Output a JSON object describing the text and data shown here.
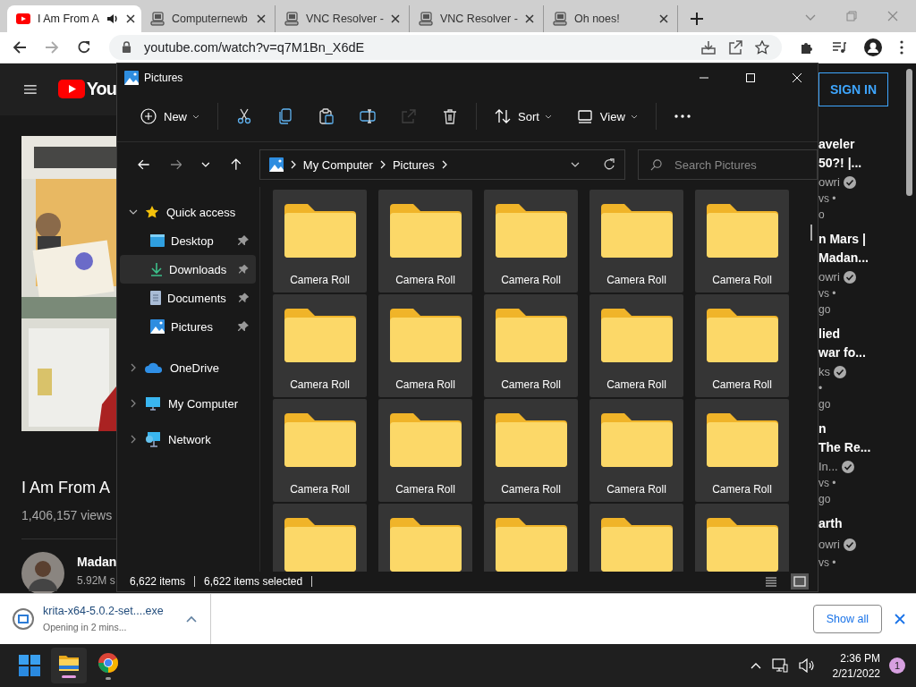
{
  "browser": {
    "tabs": [
      {
        "title": "I Am From A",
        "kind": "youtube",
        "audio": true,
        "selected": true
      },
      {
        "title": "Computernewb",
        "kind": "vnc",
        "audio": false,
        "selected": false
      },
      {
        "title": "VNC Resolver -",
        "kind": "vnc",
        "audio": false,
        "selected": false
      },
      {
        "title": "VNC Resolver -",
        "kind": "vnc",
        "audio": false,
        "selected": false
      },
      {
        "title": "Oh noes!",
        "kind": "vnc",
        "audio": false,
        "selected": false
      }
    ],
    "address": "youtube.com/watch?v=q7M1Bn_X6dE"
  },
  "youtube": {
    "logo_text": "You",
    "video_title": "I Am From A",
    "views": "1,406,157 views",
    "channel_name": "Madan",
    "subscribers": "5.92M s",
    "sign_in": "SIGN IN",
    "recommendations": [
      {
        "title_lines": [
          "aveler",
          "50?! |..."
        ],
        "channel": "owri",
        "verified": true,
        "meta_lines": [
          "vs •",
          "o"
        ]
      },
      {
        "title_lines": [
          "n Mars |",
          "Madan..."
        ],
        "channel": "owri",
        "verified": true,
        "meta_lines": [
          "vs •",
          "go"
        ]
      },
      {
        "title_lines": [
          "lied",
          "war fo..."
        ],
        "channel": "ks",
        "verified": true,
        "meta_lines": [
          "•",
          "go"
        ]
      },
      {
        "title_lines": [
          "n",
          "The Re..."
        ],
        "channel": "In...",
        "verified": true,
        "meta_lines": [
          "vs •",
          "go"
        ]
      },
      {
        "title_lines": [
          "arth"
        ],
        "channel": "owri",
        "verified": true,
        "meta_lines": [
          "vs •"
        ]
      }
    ]
  },
  "explorer": {
    "title": "Pictures",
    "toolbar": [
      {
        "kind": "new",
        "label": "New",
        "disabled": false
      },
      {
        "kind": "separator"
      },
      {
        "kind": "cut",
        "disabled": false
      },
      {
        "kind": "copy",
        "disabled": false
      },
      {
        "kind": "paste",
        "disabled": false
      },
      {
        "kind": "rename",
        "disabled": false
      },
      {
        "kind": "share",
        "disabled": true
      },
      {
        "kind": "delete",
        "disabled": false
      },
      {
        "kind": "separator"
      },
      {
        "kind": "sort",
        "label": "Sort",
        "disabled": false
      },
      {
        "kind": "view",
        "label": "View",
        "disabled": false
      },
      {
        "kind": "separator"
      },
      {
        "kind": "more",
        "disabled": false
      }
    ],
    "breadcrumb": [
      "My Computer",
      "Pictures"
    ],
    "search": {
      "placeholder": "Search Pictures"
    },
    "sidebar": [
      {
        "label": "Quick access",
        "kind": "star",
        "expanded": true,
        "selected": false,
        "children": [
          {
            "label": "Desktop",
            "kind": "desktop",
            "pinned": true,
            "selected": false
          },
          {
            "label": "Downloads",
            "kind": "downloads",
            "pinned": true,
            "selected": true
          },
          {
            "label": "Documents",
            "kind": "documents",
            "pinned": true,
            "selected": false
          },
          {
            "label": "Pictures",
            "kind": "pictures",
            "pinned": true,
            "selected": false
          }
        ]
      },
      {
        "label": "OneDrive",
        "kind": "cloud",
        "expanded": false,
        "selected": false
      },
      {
        "label": "My Computer",
        "kind": "computer",
        "expanded": false,
        "selected": false
      },
      {
        "label": "Network",
        "kind": "network",
        "expanded": false,
        "selected": false
      }
    ],
    "items": [
      {
        "label": "Camera Roll",
        "selected": true
      },
      {
        "label": "Camera Roll",
        "selected": true
      },
      {
        "label": "Camera Roll",
        "selected": true
      },
      {
        "label": "Camera Roll",
        "selected": true
      },
      {
        "label": "Camera Roll",
        "selected": true
      },
      {
        "label": "Camera Roll",
        "selected": true
      },
      {
        "label": "Camera Roll",
        "selected": true
      },
      {
        "label": "Camera Roll",
        "selected": true
      },
      {
        "label": "Camera Roll",
        "selected": true
      },
      {
        "label": "Camera Roll",
        "selected": true
      },
      {
        "label": "Camera Roll",
        "selected": true
      },
      {
        "label": "Camera Roll",
        "selected": true
      },
      {
        "label": "Camera Roll",
        "selected": true
      },
      {
        "label": "Camera Roll",
        "selected": true
      },
      {
        "label": "Camera Roll",
        "selected": true
      },
      {
        "selected": true
      },
      {
        "selected": true
      },
      {
        "selected": true
      },
      {
        "selected": true
      },
      {
        "selected": true
      }
    ],
    "status": {
      "item_count": "6,622 items",
      "selected_count": "6,622 items selected"
    },
    "views": [
      {
        "kind": "details",
        "selected": false
      },
      {
        "kind": "tiles",
        "selected": true
      }
    ]
  },
  "download_bar": {
    "file_name": "krita-x64-5.0.2-set....exe",
    "status": "Opening in 2 mins...",
    "show_all": "Show all"
  },
  "taskbar": {
    "apps": [
      {
        "kind": "explorer",
        "selected": true
      },
      {
        "kind": "chrome",
        "selected": false
      }
    ],
    "time": "2:36 PM",
    "date": "2/21/2022",
    "notification_count": "1"
  }
}
